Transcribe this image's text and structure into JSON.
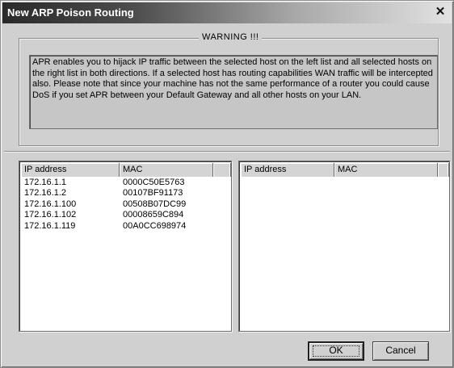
{
  "window": {
    "title": "New ARP Poison Routing",
    "close_glyph": "✕"
  },
  "warning": {
    "legend": "WARNING !!!",
    "text": "APR enables you to hijack IP traffic between the selected host on the left list and all selected hosts on the right list in both directions. If a selected host has routing capabilities WAN traffic will be intercepted also. Please note that since your machine has not the same performance of a router you could cause DoS if you set APR between your Default Gateway and all other hosts on your LAN."
  },
  "left_list": {
    "columns": [
      "IP address",
      "MAC",
      ""
    ],
    "rows": [
      {
        "ip": "172.16.1.1",
        "mac": "0000C50E5763"
      },
      {
        "ip": "172.16.1.2",
        "mac": "00107BF91173"
      },
      {
        "ip": "172.16.1.100",
        "mac": "00508B07DC99"
      },
      {
        "ip": "172.16.1.102",
        "mac": "00008659C894"
      },
      {
        "ip": "172.16.1.119",
        "mac": "00A0CC698974"
      }
    ]
  },
  "right_list": {
    "columns": [
      "IP address",
      "MAC",
      ""
    ],
    "rows": []
  },
  "buttons": {
    "ok": "OK",
    "cancel": "Cancel"
  }
}
